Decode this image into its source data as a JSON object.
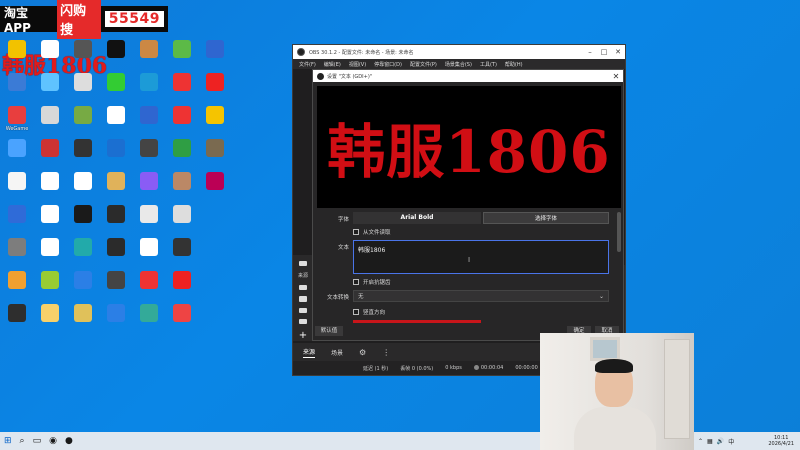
{
  "banner": {
    "app": "淘宝APP",
    "search": "闪购搜",
    "number": "55549"
  },
  "watermark": "韩服1806",
  "desktop_icons": [
    {
      "label": "",
      "color": "#f2c200"
    },
    {
      "label": "",
      "color": "#3b7bd6"
    },
    {
      "label": "WeGame",
      "color": "#e83e3e"
    },
    {
      "label": "",
      "color": "#4aa3ff"
    },
    {
      "label": "",
      "color": "#f5f5f5"
    },
    {
      "label": "",
      "color": "#2f6bd8"
    },
    {
      "label": "",
      "color": "#7d7d7d"
    },
    {
      "label": "",
      "color": "#f0a030"
    },
    {
      "label": "",
      "color": "#2e2e2e"
    },
    {
      "label": "",
      "color": "#ffffff"
    },
    {
      "label": "",
      "color": "#5fc3ff"
    },
    {
      "label": "",
      "color": "#d8d8d8"
    },
    {
      "label": "",
      "color": "#c33"
    },
    {
      "label": "",
      "color": "#ffffff"
    },
    {
      "label": "",
      "color": "#ffffff"
    },
    {
      "label": "",
      "color": "#ffffff"
    },
    {
      "label": "",
      "color": "#9c3"
    },
    {
      "label": "",
      "color": "#f7d06a"
    },
    {
      "label": "",
      "color": "#555"
    },
    {
      "label": "",
      "color": "#ddd"
    },
    {
      "label": "",
      "color": "#7a4"
    },
    {
      "label": "",
      "color": "#333"
    },
    {
      "label": "",
      "color": "#ffffff"
    },
    {
      "label": "",
      "color": "#1a1a1a"
    },
    {
      "label": "",
      "color": "#2aa"
    },
    {
      "label": "",
      "color": "#2b7fe6"
    },
    {
      "label": "",
      "color": "#e0c15a"
    },
    {
      "label": "",
      "color": "#111"
    },
    {
      "label": "",
      "color": "#3c3"
    },
    {
      "label": "",
      "color": "#ffffff"
    },
    {
      "label": "",
      "color": "#1b6fd1"
    },
    {
      "label": "",
      "color": "#e0b25a"
    },
    {
      "label": "",
      "color": "#2b2b2b"
    },
    {
      "label": "",
      "color": "#2b2b2b"
    },
    {
      "label": "",
      "color": "#444"
    },
    {
      "label": "",
      "color": "#2b7fe6"
    },
    {
      "label": "",
      "color": "#c84"
    },
    {
      "label": "",
      "color": "#1c9bd7"
    },
    {
      "label": "",
      "color": "#2f66d0"
    },
    {
      "label": "",
      "color": "#444"
    },
    {
      "label": "",
      "color": "#8a5cf5"
    },
    {
      "label": "",
      "color": "#e9e9e9"
    },
    {
      "label": "",
      "color": "#ffffff"
    },
    {
      "label": "",
      "color": "#e33"
    },
    {
      "label": "",
      "color": "#3a9"
    },
    {
      "label": "",
      "color": "#5cba47"
    },
    {
      "label": "",
      "color": "#e33"
    },
    {
      "label": "",
      "color": "#e33"
    },
    {
      "label": "",
      "color": "#2f9e44"
    },
    {
      "label": "",
      "color": "#b86"
    },
    {
      "label": "",
      "color": "#ddd"
    },
    {
      "label": "",
      "color": "#333"
    },
    {
      "label": "",
      "color": "#e22"
    },
    {
      "label": "",
      "color": "#e44"
    },
    {
      "label": "",
      "color": "#2f66d0"
    },
    {
      "label": "",
      "color": "#e22"
    },
    {
      "label": "",
      "color": "#f5c400"
    },
    {
      "label": "",
      "color": "#7a6a50"
    },
    {
      "label": "",
      "color": "#b05"
    }
  ],
  "obs": {
    "title": "OBS 30.1.2 - 配置文件: 未命名 - 场景: 未命名",
    "menu": [
      "文件(F)",
      "编辑(E)",
      "视图(V)",
      "停靠窗口(D)",
      "配置文件(P)",
      "场景集合(S)",
      "工具(T)",
      "帮助(H)"
    ],
    "side_label": "来源",
    "bottom_tabs": [
      "来源",
      "场景"
    ],
    "status": {
      "delay": "延迟 (1 秒)",
      "dropped": "丢帧 0 (0.0%)",
      "kbps": "0 kbps",
      "time": "00:00:04",
      "time2": "00:00:00"
    }
  },
  "dialog": {
    "title": "设置 \"文本 (GDI+)\"",
    "preview_text": "韩服1806",
    "font_label": "字体",
    "font_value": "Arial Bold",
    "select_font": "选择字体",
    "from_file": "从文件读取",
    "text_label": "文本",
    "text_value": "韩服1806",
    "antialias": "开启抗锯齿",
    "wrap_label": "文本转换",
    "wrap_value": "无",
    "vertical": "竖直方向",
    "defaults": "默认值",
    "ok": "确定",
    "cancel": "取消"
  },
  "taskbar": {
    "clock_time": "10:11",
    "clock_date": "2026/4/21"
  }
}
